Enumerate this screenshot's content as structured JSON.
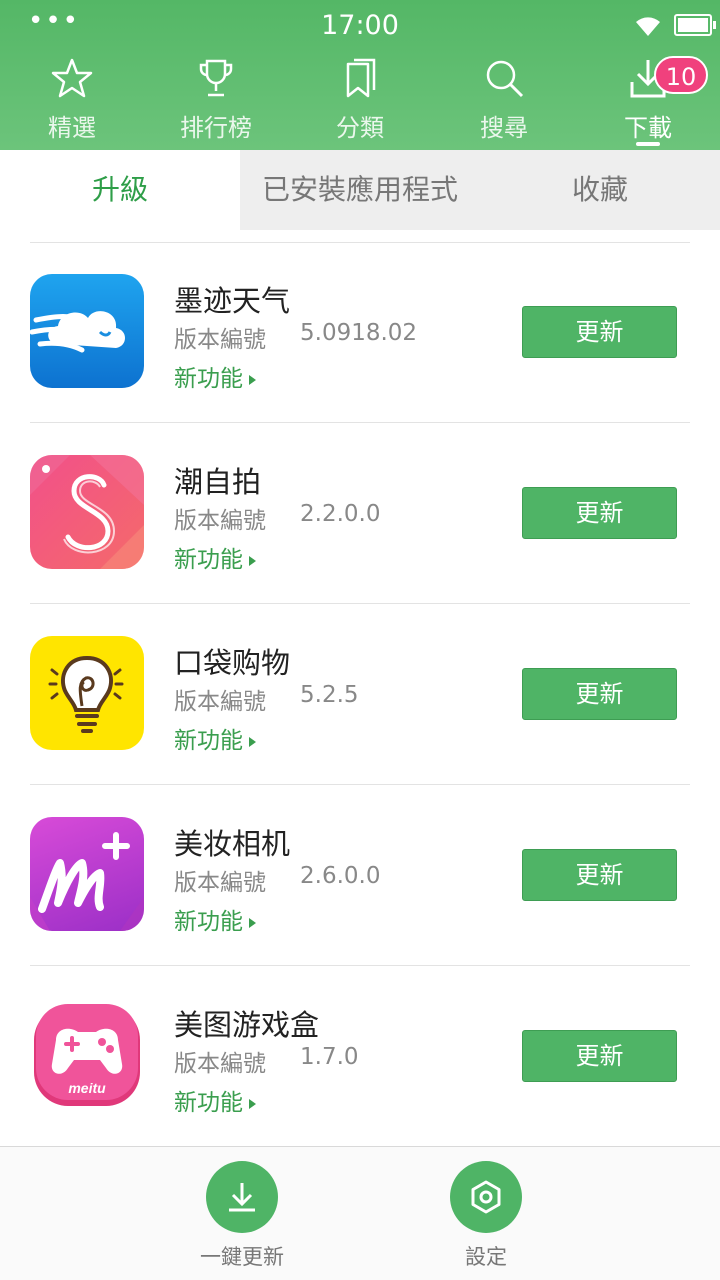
{
  "status_bar": {
    "time": "17:00",
    "dots": "•••"
  },
  "nav_tabs": [
    {
      "label": "精選",
      "icon": "star-icon"
    },
    {
      "label": "排行榜",
      "icon": "trophy-icon"
    },
    {
      "label": "分類",
      "icon": "bookmark-icon"
    },
    {
      "label": "搜尋",
      "icon": "search-icon"
    },
    {
      "label": "下載",
      "icon": "download-icon",
      "active": true,
      "badge": "10"
    }
  ],
  "segments": [
    {
      "label": "升級",
      "active": true
    },
    {
      "label": "已安裝應用程式"
    },
    {
      "label": "收藏"
    }
  ],
  "apps": [
    {
      "name": "墨迹天气",
      "version_label": "版本編號",
      "version": "5.0918.02",
      "whats_new": "新功能",
      "button": "更新",
      "icon": "weather-cloud-icon"
    },
    {
      "name": "潮自拍",
      "version_label": "版本編號",
      "version": "2.2.0.0",
      "whats_new": "新功能",
      "button": "更新",
      "icon": "selfie-s-icon"
    },
    {
      "name": "口袋购物",
      "version_label": "版本編號",
      "version": "5.2.5",
      "whats_new": "新功能",
      "button": "更新",
      "icon": "lightbulb-icon"
    },
    {
      "name": "美妆相机",
      "version_label": "版本編號",
      "version": "2.6.0.0",
      "whats_new": "新功能",
      "button": "更新",
      "icon": "makeup-m-icon"
    },
    {
      "name": "美图游戏盒",
      "version_label": "版本編號",
      "version": "1.7.0",
      "whats_new": "新功能",
      "button": "更新",
      "icon": "gamepad-icon",
      "icon_text": "meitu"
    }
  ],
  "bottom_bar": {
    "update_all": "一鍵更新",
    "settings": "設定"
  },
  "colors": {
    "brand_green": "#54b766",
    "badge_pink": "#f0417d",
    "button_green": "#4fb466"
  }
}
